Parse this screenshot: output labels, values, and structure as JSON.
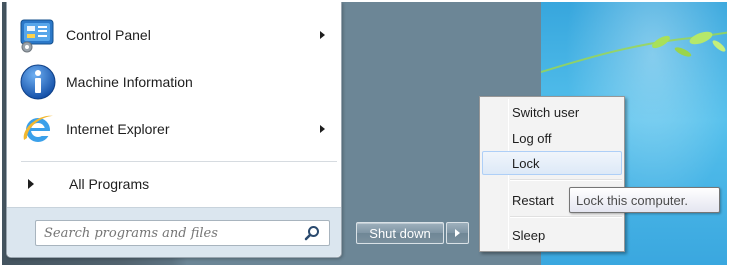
{
  "start_menu": {
    "programs": [
      {
        "label": "Control Panel",
        "icon": "control-panel-icon",
        "has_submenu": true
      },
      {
        "label": "Machine Information",
        "icon": "info-icon",
        "has_submenu": false
      },
      {
        "label": "Internet Explorer",
        "icon": "internet-explorer-icon",
        "has_submenu": true
      }
    ],
    "all_programs_label": "All Programs",
    "search": {
      "placeholder": "Search programs and files",
      "value": ""
    }
  },
  "shutdown": {
    "button_label": "Shut down",
    "arrow_icon": "right-arrow-icon"
  },
  "power_menu": {
    "items": [
      {
        "label": "Switch user",
        "highlighted": false
      },
      {
        "label": "Log off",
        "highlighted": false
      },
      {
        "label": "Lock",
        "highlighted": true
      },
      {
        "label": "Restart",
        "highlighted": false
      },
      {
        "label": "Sleep",
        "highlighted": false
      }
    ]
  },
  "tooltip": {
    "text": "Lock this computer."
  },
  "colors": {
    "highlight": "#dde9f7",
    "desktop": "#4f606c",
    "wallpaper": "#3aa7df"
  }
}
